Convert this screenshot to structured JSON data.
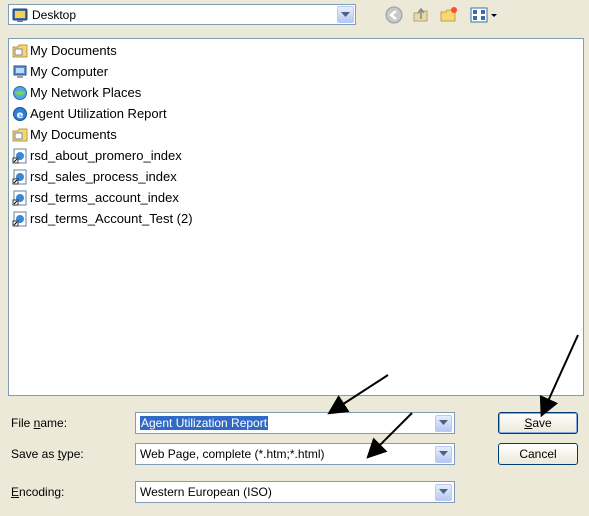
{
  "look_in": {
    "value": "Desktop",
    "icon": "desktop-icon"
  },
  "toolbar": {
    "back_icon": "back-icon",
    "up_icon": "up-folder-icon",
    "new_folder_icon": "new-folder-icon",
    "views_icon": "views-menu-icon"
  },
  "files": [
    {
      "name": "My Documents",
      "icon": "my-documents-icon"
    },
    {
      "name": "My Computer",
      "icon": "my-computer-icon"
    },
    {
      "name": "My Network Places",
      "icon": "network-places-icon"
    },
    {
      "name": "Agent Utilization Report",
      "icon": "ie-page-icon"
    },
    {
      "name": "My Documents",
      "icon": "my-documents-icon"
    },
    {
      "name": "rsd_about_promero_index",
      "icon": "web-shortcut-icon"
    },
    {
      "name": "rsd_sales_process_index",
      "icon": "web-shortcut-icon"
    },
    {
      "name": "rsd_terms_account_index",
      "icon": "web-shortcut-icon"
    },
    {
      "name": "rsd_terms_Account_Test (2)",
      "icon": "web-shortcut-icon"
    }
  ],
  "form": {
    "file_name_label_pre": "File ",
    "file_name_label_u": "n",
    "file_name_label_post": "ame:",
    "file_name_value": "Agent Utilization Report",
    "save_type_label_pre": "Save as ",
    "save_type_label_u": "t",
    "save_type_label_post": "ype:",
    "save_type_value": "Web Page, complete (*.htm;*.html)",
    "encoding_label_u": "E",
    "encoding_label_post": "ncoding:",
    "encoding_value": "Western European (ISO)"
  },
  "buttons": {
    "save_u": "S",
    "save_post": "ave",
    "cancel": "Cancel"
  }
}
